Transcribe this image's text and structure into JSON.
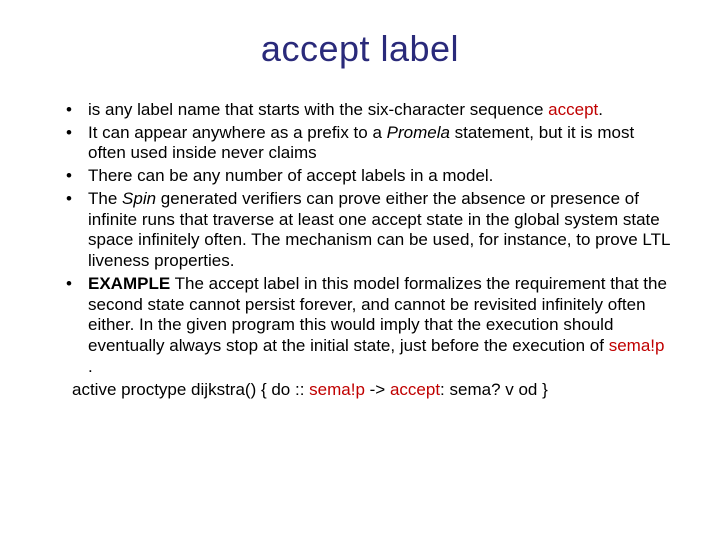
{
  "title": "accept label",
  "bullets": {
    "b1": {
      "pre": "is any label name that starts with the six-character sequence ",
      "kw": "accept",
      "post": "."
    },
    "b2": {
      "pre": "It can appear anywhere as a prefix to a ",
      "em": "Promela",
      "post": " statement, but it is most often used inside never claims"
    },
    "b3": {
      "text": "There can be any number of accept labels in a model."
    },
    "b4": {
      "pre": "The ",
      "em": "Spin",
      "post": " generated verifiers can prove either the absence or presence of infinite runs that traverse at least one accept state in the global system state space infinitely often. The mechanism can be used, for instance, to prove LTL liveness properties."
    },
    "b5": {
      "strong": "EXAMPLE",
      "pre": " The accept label in this model formalizes the requirement that the second state cannot persist forever, and cannot be revisited infinitely often either. In the given program this would imply that the execution should eventually always stop at the initial state, just before the execution of ",
      "kw": "sema!p",
      "post": " ."
    }
  },
  "code": {
    "p1": "active proctype dijkstra() { do :: ",
    "kw1": "sema!p",
    "p2": " -> ",
    "kw2": "accept",
    "p3": ": sema? v od }"
  }
}
